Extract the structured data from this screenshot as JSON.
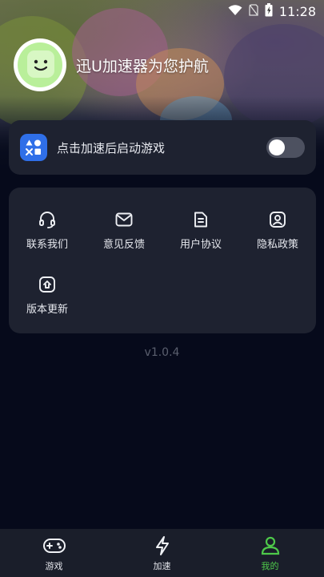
{
  "status_bar": {
    "time": "11:28",
    "icons": [
      "wifi-icon",
      "no-sim-icon",
      "battery-charging-icon"
    ]
  },
  "profile": {
    "slogan": "迅U加速器为您护航",
    "avatar_icon": "smiley-avatar-icon"
  },
  "auto_launch": {
    "label": "点击加速后启动游戏",
    "enabled": false,
    "icon": "game-shapes-icon",
    "accent": "#2f6fe8"
  },
  "menu": {
    "items": [
      {
        "label": "联系我们",
        "icon": "headset-icon"
      },
      {
        "label": "意见反馈",
        "icon": "mail-icon"
      },
      {
        "label": "用户协议",
        "icon": "document-icon"
      },
      {
        "label": "隐私政策",
        "icon": "privacy-shield-icon"
      },
      {
        "label": "版本更新",
        "icon": "update-upload-icon"
      }
    ]
  },
  "version": "v1.0.4",
  "bottom_nav": {
    "items": [
      {
        "label": "游戏",
        "icon": "gamepad-icon",
        "active": false
      },
      {
        "label": "加速",
        "icon": "lightning-icon",
        "active": false
      },
      {
        "label": "我的",
        "icon": "user-icon",
        "active": true
      }
    ],
    "active_color": "#4ec94a"
  }
}
